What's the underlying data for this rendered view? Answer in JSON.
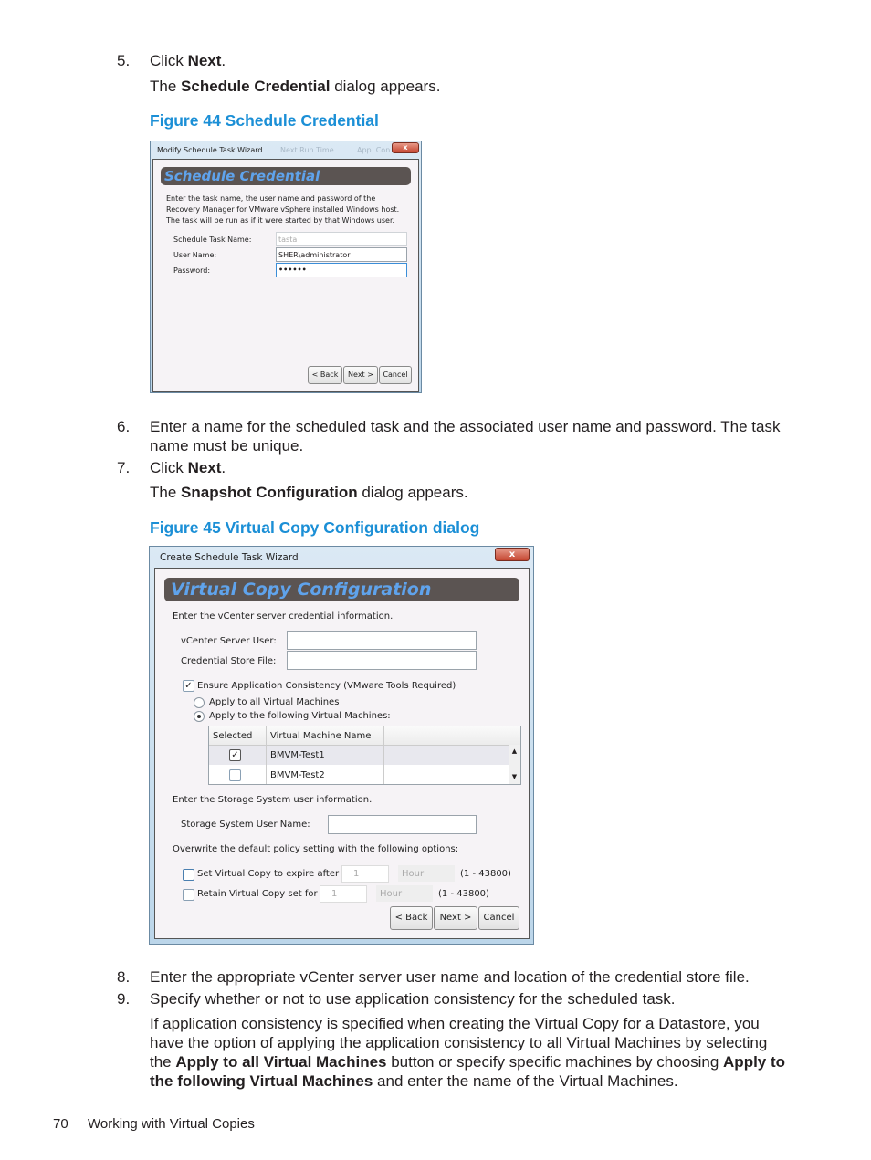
{
  "steps": {
    "s5": {
      "num": "5.",
      "pre": "Click ",
      "bold": "Next",
      "post": ".",
      "line2_pre": "The ",
      "line2_bold": "Schedule Credential",
      "line2_post": " dialog appears."
    },
    "fig44": "Figure 44 Schedule Credential",
    "s6": {
      "num": "6.",
      "line1": "Enter a name for the scheduled task and the associated user name and password. The task",
      "line2": "name must be unique."
    },
    "s7": {
      "num": "7.",
      "pre": "Click ",
      "bold": "Next",
      "post": ".",
      "line2_pre": "The ",
      "line2_bold": "Snapshot Configuration",
      "line2_post": " dialog appears."
    },
    "fig45": "Figure 45 Virtual Copy Configuration dialog",
    "s8": {
      "num": "8.",
      "text": "Enter the appropriate vCenter server user name and location of the credential store file."
    },
    "s9": {
      "num": "9.",
      "text": "Specify whether or not to use application consistency for the scheduled task.",
      "p1": "If application consistency is specified when creating the Virtual Copy for a Datastore, you",
      "p2": "have the option of applying the application consistency to all Virtual Machines by selecting",
      "p3_a": "the ",
      "p3_b": "Apply to all Virtual Machines",
      "p3_c": " button or specify specific machines by choosing ",
      "p3_d": "Apply to",
      "p4_a": "the following Virtual Machines",
      "p4_b": " and enter the name of the Virtual Machines."
    }
  },
  "dialog44": {
    "title": "Modify Schedule Task Wizard",
    "tab2": "Next Run Time",
    "tab3": "App. Con",
    "close": "x",
    "header": "Schedule Credential",
    "desc1": "Enter the task name, the user name and password of the",
    "desc2": "Recovery Manager for VMware vSphere installed Windows host.",
    "desc3": "The task will be run as if it were started by that Windows user.",
    "task_label": "Schedule Task Name:",
    "task_value": "tasta",
    "user_label": "User Name:",
    "user_value": "SHER\\administrator",
    "pw_label": "Password:",
    "pw_value": "••••••",
    "back": "< Back",
    "next": "Next >",
    "cancel": "Cancel"
  },
  "dialog45": {
    "title": "Create Schedule Task Wizard",
    "close": "x",
    "header": "Virtual Copy Configuration",
    "vc_intro": "Enter the vCenter server credential information.",
    "vc_user_label": "vCenter Server User:",
    "vc_user_value": "",
    "cred_label": "Credential Store File:",
    "cred_value": "",
    "ensure_label": "Ensure Application Consistency (VMware Tools Required)",
    "ensure_checked": true,
    "radio_all": "Apply to all Virtual Machines",
    "radio_following": "Apply to the following Virtual Machines:",
    "radio_selected": "following",
    "table": {
      "headers": [
        "Selected",
        "Virtual Machine Name"
      ],
      "rows": [
        {
          "selected": true,
          "name": "BMVM-Test1"
        },
        {
          "selected": false,
          "name": "BMVM-Test2"
        }
      ]
    },
    "storage_intro": "Enter the Storage System user information.",
    "storage_label": "Storage System User Name:",
    "storage_value": "",
    "overwrite": "Overwrite the default policy setting with the following options:",
    "expire_label": "Set Virtual Copy to expire after",
    "expire_value": "1",
    "expire_unit": "Hour",
    "expire_range": "(1 - 43800)",
    "retain_label": "Retain Virtual Copy set for",
    "retain_value": "1",
    "retain_unit": "Hour",
    "retain_range": "(1 - 43800)",
    "back": "< Back",
    "next": "Next >",
    "cancel": "Cancel"
  },
  "footer": {
    "page": "70",
    "section": "Working with Virtual Copies"
  }
}
